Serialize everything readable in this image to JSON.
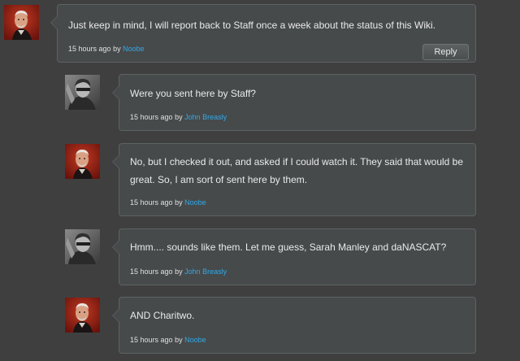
{
  "comments": [
    {
      "text": "Just keep in mind, I will report back to Staff once a week about the status of this Wiki.",
      "time": "15 hours ago",
      "by": "by",
      "author": "Noobe",
      "avatar": "red-portrait-avatar",
      "reply_label": "Reply"
    },
    {
      "text": "Were you sent here by Staff?",
      "time": "15 hours ago",
      "by": "by",
      "author": "John Breasly",
      "avatar": "gray-portrait-avatar"
    },
    {
      "text": "No, but I checked it out, and asked if I could watch it. They said that would be great. So, I am sort of sent here by them.",
      "time": "15 hours ago",
      "by": "by",
      "author": "Noobe",
      "avatar": "red-portrait-avatar"
    },
    {
      "text": "Hmm.... sounds like them. Let me guess, Sarah Manley and daNASCAT?",
      "time": "15 hours ago",
      "by": "by",
      "author": "John Breasly",
      "avatar": "gray-portrait-avatar"
    },
    {
      "text": "AND Charitwo.",
      "time": "15 hours ago",
      "by": "by",
      "author": "Noobe",
      "avatar": "red-portrait-avatar"
    }
  ],
  "colors": {
    "background": "#3f3f3f",
    "bubble": "#464a4b",
    "bubble_border": "#5d6263",
    "author_link": "#32a8e8"
  }
}
